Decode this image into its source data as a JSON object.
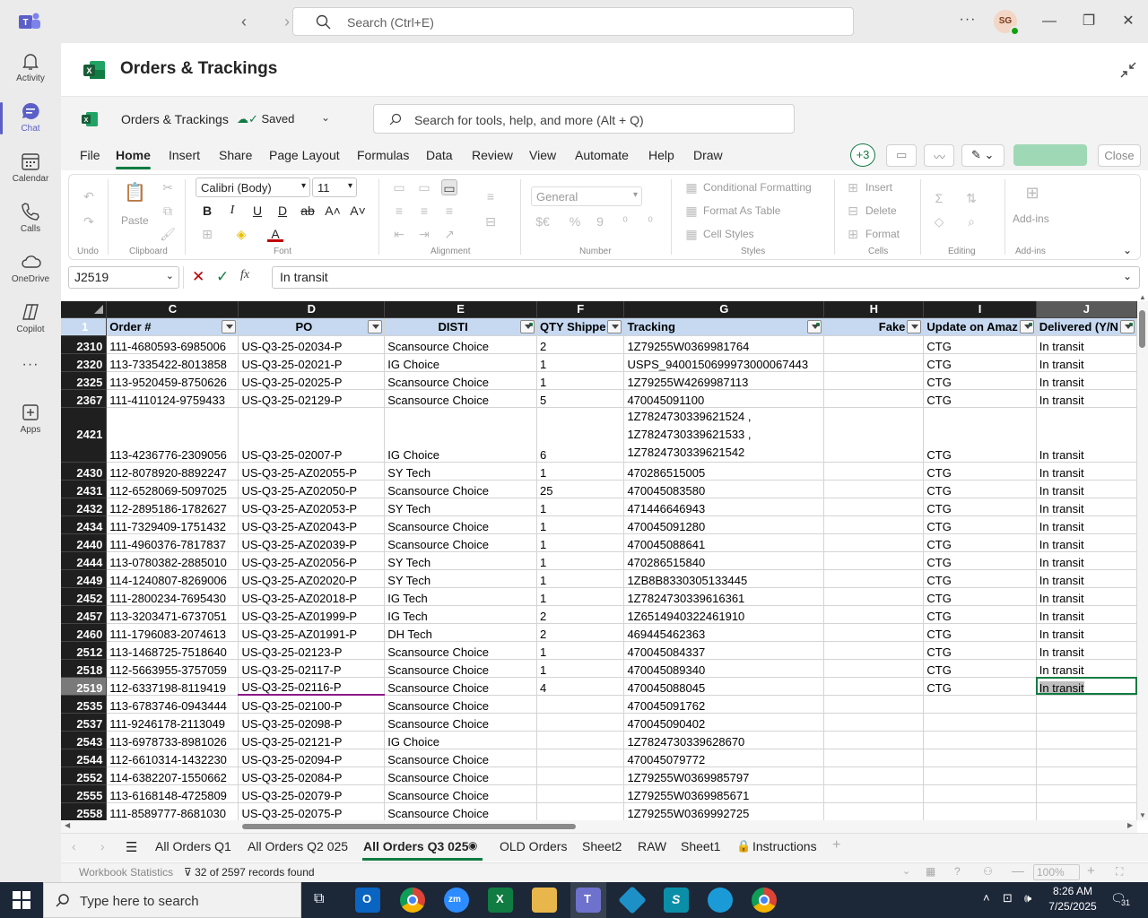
{
  "teams": {
    "search_placeholder": "Search (Ctrl+E)",
    "avatar_initials": "SG",
    "more_label": "···",
    "rail": [
      {
        "label": "Activity",
        "icon": "bell-icon"
      },
      {
        "label": "Chat",
        "icon": "chat-icon"
      },
      {
        "label": "Calendar",
        "icon": "calendar-icon"
      },
      {
        "label": "Calls",
        "icon": "phone-icon"
      },
      {
        "label": "OneDrive",
        "icon": "cloud-icon"
      },
      {
        "label": "Copilot",
        "icon": "copilot-icon"
      },
      {
        "label": "···",
        "icon": "more-icon"
      },
      {
        "label": "Apps",
        "icon": "apps-icon"
      }
    ],
    "rail_active": "Chat",
    "app_title": "Orders & Trackings"
  },
  "excel": {
    "workbook_name": "Orders & Trackings",
    "saved_label": "Saved",
    "search_placeholder": "Search for tools, help, and more (Alt + Q)",
    "menu": [
      "File",
      "Home",
      "Insert",
      "Share",
      "Page Layout",
      "Formulas",
      "Data",
      "Review",
      "View",
      "Automate",
      "Help",
      "Draw"
    ],
    "active_menu": "Home",
    "coauthors": "+3",
    "close_label": "Close",
    "ribbon": {
      "undo_group": "Undo",
      "clipboard_group": "Clipboard",
      "paste_label": "Paste",
      "font_name": "Calibri (Body)",
      "font_size": "11",
      "font_group": "Font",
      "alignment_group": "Alignment",
      "number_format": "General",
      "number_group": "Number",
      "conditional_formatting": "Conditional Formatting",
      "format_as_table": "Format As Table",
      "cell_styles": "Cell Styles",
      "styles_group": "Styles",
      "insert": "Insert",
      "delete": "Delete",
      "format": "Format",
      "cells_group": "Cells",
      "editing_group": "Editing",
      "addins_label": "Add-ins",
      "addins_group": "Add-ins"
    },
    "name_box": "J2519",
    "formula_value": "In transit",
    "fx_label": "fx",
    "columns": [
      "C",
      "D",
      "E",
      "F",
      "G",
      "H",
      "I",
      "J"
    ],
    "selected_column": "J",
    "header_row_number": "1",
    "headers": [
      "Order #",
      "PO",
      "DISTI",
      "QTY Shippe",
      "Tracking",
      "Fake",
      "Update on Amaz",
      "Delivered (Y/N"
    ],
    "header_filters_on": [
      false,
      false,
      true,
      false,
      true,
      false,
      true,
      true
    ],
    "rows": [
      {
        "n": "2310",
        "c": [
          "111-4680593-6985006",
          "US-Q3-25-02034-P",
          "Scansource Choice",
          "2",
          "1Z79255W0369981764",
          "",
          "CTG",
          "In transit"
        ]
      },
      {
        "n": "2320",
        "c": [
          "113-7335422-8013858",
          "US-Q3-25-02021-P",
          "IG Choice",
          "1",
          "USPS_9400150699973000067443",
          "",
          "CTG",
          "In transit"
        ]
      },
      {
        "n": "2325",
        "c": [
          "113-9520459-8750626",
          "US-Q3-25-02025-P",
          "Scansource Choice",
          "1",
          "1Z79255W4269987113",
          "",
          "CTG",
          "In transit"
        ]
      },
      {
        "n": "2367",
        "c": [
          "111-4110124-9759433",
          "US-Q3-25-02129-P",
          "Scansource Choice",
          "5",
          "470045091100",
          "",
          "CTG",
          "In transit"
        ]
      },
      {
        "n": "2421",
        "tall": true,
        "c": [
          "113-4236776-2309056",
          "US-Q3-25-02007-P",
          "IG Choice",
          "6",
          "1Z7824730339621524 ,|1Z7824730339621533 ,|1Z7824730339621542",
          "",
          "CTG",
          "In transit"
        ]
      },
      {
        "n": "2430",
        "c": [
          "112-8078920-8892247",
          "US-Q3-25-AZ02055-P",
          "SY Tech",
          "1",
          "470286515005",
          "",
          "CTG",
          "In transit"
        ]
      },
      {
        "n": "2431",
        "c": [
          "112-6528069-5097025",
          "US-Q3-25-AZ02050-P",
          "Scansource Choice",
          "25",
          "470045083580",
          "",
          "CTG",
          "In transit"
        ]
      },
      {
        "n": "2432",
        "c": [
          "112-2895186-1782627",
          "US-Q3-25-AZ02053-P",
          "SY Tech",
          "1",
          "471446646943",
          "",
          "CTG",
          "In transit"
        ]
      },
      {
        "n": "2434",
        "c": [
          "111-7329409-1751432",
          "US-Q3-25-AZ02043-P",
          "Scansource Choice",
          "1",
          "470045091280",
          "",
          "CTG",
          "In transit"
        ]
      },
      {
        "n": "2440",
        "c": [
          "111-4960376-7817837",
          "US-Q3-25-AZ02039-P",
          "Scansource Choice",
          "1",
          "470045088641",
          "",
          "CTG",
          "In transit"
        ]
      },
      {
        "n": "2444",
        "c": [
          "113-0780382-2885010",
          "US-Q3-25-AZ02056-P",
          "SY Tech",
          "1",
          "470286515840",
          "",
          "CTG",
          "In transit"
        ]
      },
      {
        "n": "2449",
        "c": [
          "114-1240807-8269006",
          "US-Q3-25-AZ02020-P",
          "SY Tech",
          "1",
          "1ZB8B8330305133445",
          "",
          "CTG",
          "In transit"
        ]
      },
      {
        "n": "2452",
        "c": [
          "111-2800234-7695430",
          "US-Q3-25-AZ02018-P",
          "IG Tech",
          "1",
          "1Z7824730339616361",
          "",
          "CTG",
          "In transit"
        ]
      },
      {
        "n": "2457",
        "c": [
          "113-3203471-6737051",
          "US-Q3-25-AZ01999-P",
          "IG Tech",
          "2",
          "1Z6514940322461910",
          "",
          "CTG",
          "In transit"
        ]
      },
      {
        "n": "2460",
        "c": [
          "111-1796083-2074613",
          "US-Q3-25-AZ01991-P",
          "DH Tech",
          "2",
          "469445462363",
          "",
          "CTG",
          "In transit"
        ]
      },
      {
        "n": "2512",
        "c": [
          "113-1468725-7518640",
          "US-Q3-25-02123-P",
          "Scansource Choice",
          "1",
          "470045084337",
          "",
          "CTG",
          "In transit"
        ]
      },
      {
        "n": "2518",
        "c": [
          "112-5663955-3757059",
          "US-Q3-25-02117-P",
          "Scansource Choice",
          "1",
          "470045089340",
          "",
          "CTG",
          "In transit"
        ]
      },
      {
        "n": "2519",
        "sel": true,
        "c": [
          "112-6337198-8119419",
          "US-Q3-25-02116-P",
          "Scansource Choice",
          "4",
          "470045088045",
          "",
          "CTG",
          "In transit"
        ]
      },
      {
        "n": "2535",
        "c": [
          "113-6783746-0943444",
          "US-Q3-25-02100-P",
          "Scansource Choice",
          "",
          "470045091762",
          "",
          "",
          ""
        ]
      },
      {
        "n": "2537",
        "c": [
          "111-9246178-2113049",
          "US-Q3-25-02098-P",
          "Scansource Choice",
          "",
          "470045090402",
          "",
          "",
          ""
        ]
      },
      {
        "n": "2543",
        "c": [
          "113-6978733-8981026",
          "US-Q3-25-02121-P",
          "IG Choice",
          "",
          "1Z7824730339628670",
          "",
          "",
          ""
        ]
      },
      {
        "n": "2544",
        "c": [
          "112-6610314-1432230",
          "US-Q3-25-02094-P",
          "Scansource Choice",
          "",
          "470045079772",
          "",
          "",
          ""
        ]
      },
      {
        "n": "2552",
        "c": [
          "114-6382207-1550662",
          "US-Q3-25-02084-P",
          "Scansource Choice",
          "",
          "1Z79255W0369985797",
          "",
          "",
          ""
        ]
      },
      {
        "n": "2555",
        "c": [
          "113-6168148-4725809",
          "US-Q3-25-02079-P",
          "Scansource Choice",
          "",
          "1Z79255W0369985671",
          "",
          "",
          ""
        ]
      },
      {
        "n": "2558",
        "c": [
          "111-8589777-8681030",
          "US-Q3-25-02075-P",
          "Scansource Choice",
          "",
          "1Z79255W0369992725",
          "",
          "",
          ""
        ]
      }
    ],
    "sheet_tabs": [
      "All Orders Q1",
      "All Orders Q2 025",
      "All Orders Q3 025",
      "OLD Orders",
      "Sheet2",
      "RAW",
      "Sheet1",
      "Instructions"
    ],
    "active_sheet": "All Orders Q3 025",
    "status_left": "Workbook Statistics",
    "status_records": "32 of 2597 records found",
    "zoom": "100%",
    "accent_color": "#107c41"
  },
  "taskbar": {
    "search_placeholder": "Type here to search",
    "time": "8:26 AM",
    "date": "7/25/2025",
    "notification_count": "31"
  }
}
